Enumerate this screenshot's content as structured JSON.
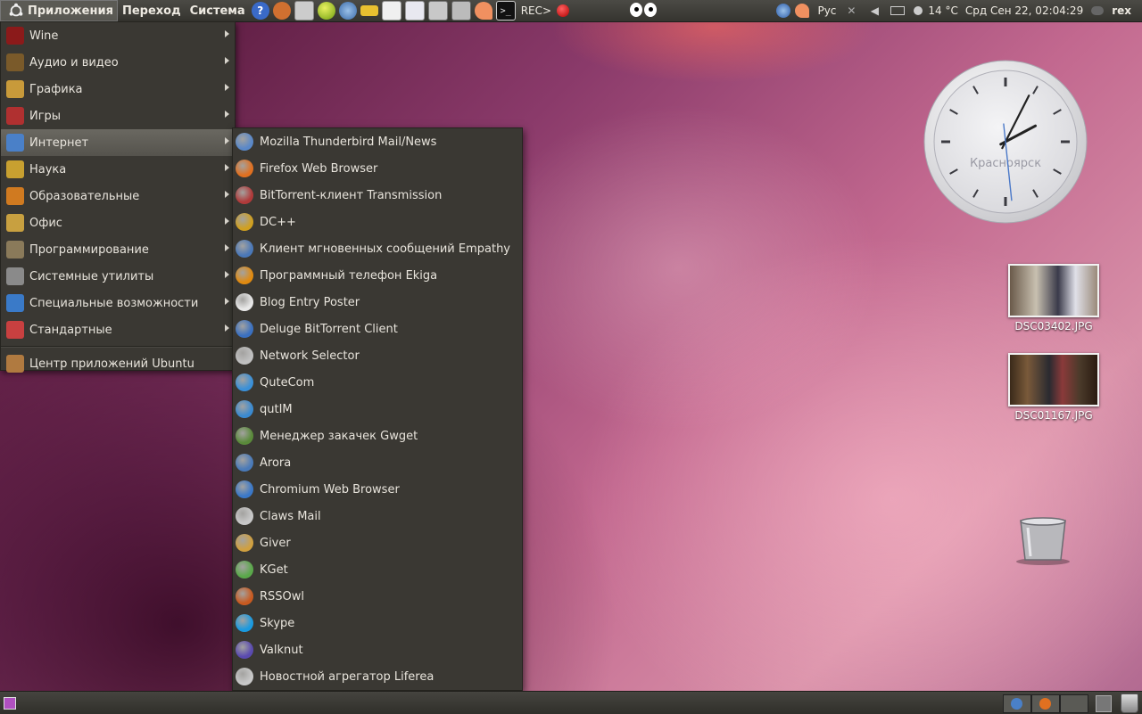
{
  "top_panel": {
    "menus": [
      "Приложения",
      "Переход",
      "Система"
    ],
    "rec_label": "REC>",
    "layout_indicator": "Рус",
    "weather": "14 °C",
    "datetime": "Срд Сен 22, 02:04:29",
    "user": "rex"
  },
  "apps_menu": {
    "items": [
      {
        "label": "Wine",
        "icon": "wine-icon",
        "color": "#8b1a1a"
      },
      {
        "label": "Аудио и видео",
        "icon": "multimedia-icon",
        "color": "#7a5a2a"
      },
      {
        "label": "Графика",
        "icon": "graphics-icon",
        "color": "#c89a3a"
      },
      {
        "label": "Игры",
        "icon": "games-icon",
        "color": "#b03030"
      },
      {
        "label": "Интернет",
        "icon": "internet-icon",
        "color": "#4a80c8"
      },
      {
        "label": "Наука",
        "icon": "science-icon",
        "color": "#c8a030"
      },
      {
        "label": "Образовательные",
        "icon": "education-icon",
        "color": "#d07a20"
      },
      {
        "label": "Офис",
        "icon": "office-icon",
        "color": "#c8a040"
      },
      {
        "label": "Программирование",
        "icon": "programming-icon",
        "color": "#8a7a5a"
      },
      {
        "label": "Системные утилиты",
        "icon": "system-tools-icon",
        "color": "#8a8a8a"
      },
      {
        "label": "Специальные возможности",
        "icon": "accessibility-icon",
        "color": "#3a7ac8"
      },
      {
        "label": "Стандартные",
        "icon": "accessories-icon",
        "color": "#c84040"
      }
    ],
    "software_center": {
      "label": "Центр приложений Ubuntu",
      "icon": "software-center-icon",
      "color": "#b07a40"
    }
  },
  "internet_submenu": {
    "items": [
      {
        "label": "Mozilla Thunderbird Mail/News",
        "icon": "thunderbird-icon",
        "color": "#5a88c8"
      },
      {
        "label": "Firefox Web Browser",
        "icon": "firefox-icon",
        "color": "#e07020"
      },
      {
        "label": "BitTorrent-клиент Transmission",
        "icon": "transmission-icon",
        "color": "#b03a3a"
      },
      {
        "label": "DC++",
        "icon": "dcpp-icon",
        "color": "#d0a020"
      },
      {
        "label": "Клиент мгновенных сообщений Empathy",
        "icon": "empathy-icon",
        "color": "#4a78b8"
      },
      {
        "label": "Программный телефон Ekiga",
        "icon": "ekiga-icon",
        "color": "#e08a10"
      },
      {
        "label": "Blog Entry Poster",
        "icon": "blog-icon",
        "color": "#e8e8e8"
      },
      {
        "label": "Deluge BitTorrent Client",
        "icon": "deluge-icon",
        "color": "#3a70c0"
      },
      {
        "label": "Network Selector",
        "icon": "network-icon",
        "color": "#c0c0c0"
      },
      {
        "label": "QuteCom",
        "icon": "qutecom-icon",
        "color": "#3a90d8"
      },
      {
        "label": "qutIM",
        "icon": "qutim-icon",
        "color": "#3a8ad0"
      },
      {
        "label": "Менеджер закачек Gwget",
        "icon": "gwget-icon",
        "color": "#5a8a3a"
      },
      {
        "label": "Arora",
        "icon": "arora-icon",
        "color": "#4a7ab8"
      },
      {
        "label": "Chromium Web Browser",
        "icon": "chromium-icon",
        "color": "#3a78c8"
      },
      {
        "label": "Claws Mail",
        "icon": "claws-mail-icon",
        "color": "#c8c8c8"
      },
      {
        "label": "Giver",
        "icon": "giver-icon",
        "color": "#d0a040"
      },
      {
        "label": "KGet",
        "icon": "kget-icon",
        "color": "#5aa84a"
      },
      {
        "label": "RSSOwl",
        "icon": "rssowl-icon",
        "color": "#c85a20"
      },
      {
        "label": "Skype",
        "icon": "skype-icon",
        "color": "#1a9ae0"
      },
      {
        "label": "Valknut",
        "icon": "valknut-icon",
        "color": "#5a4ab0"
      },
      {
        "label": "Новостной агрегатор Liferea",
        "icon": "liferea-icon",
        "color": "#c8c8c8"
      }
    ]
  },
  "clock_widget": {
    "city": "Красноярск",
    "hour": 2,
    "minute": 4,
    "second": 29
  },
  "desktop_icons": [
    {
      "label": "DSC03402.JPG",
      "icon": "photo-thumbnail-icon"
    },
    {
      "label": "DSC01167.JPG",
      "icon": "photo-thumbnail-icon"
    }
  ],
  "trash": {
    "icon": "trash-icon"
  }
}
